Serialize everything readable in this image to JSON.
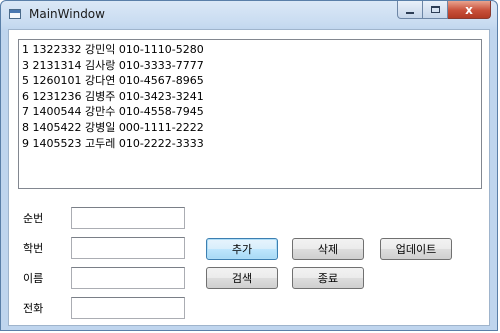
{
  "window": {
    "title": "MainWindow",
    "close_glyph": "x",
    "min_icon": "minimize-icon",
    "max_icon": "maximize-icon",
    "app_icon": "window-icon"
  },
  "list": {
    "items": [
      "1 1322332 강민익 010-1110-5280",
      "3 2131314 김사랑 010-3333-7777",
      "5 1260101 강다연 010-4567-8965",
      "6 1231236 김병주 010-3423-3241",
      "7 1400544 강만수 010-4558-7945",
      "8 1405422 강병일 000-1111-2222",
      "9 1405523 고두레 010-2222-3333"
    ]
  },
  "form": {
    "labels": {
      "number": "순번",
      "student_id": "학번",
      "name": "이름",
      "phone": "전화"
    },
    "values": {
      "number": "",
      "student_id": "",
      "name": "",
      "phone": ""
    }
  },
  "buttons": {
    "add": "추가",
    "delete": "삭제",
    "update": "업데이트",
    "search": "검색",
    "exit": "종료"
  },
  "colors": {
    "close_button": "#c8503a",
    "default_button_border": "#3c7fb1",
    "window_frame": "#bfd5ee"
  }
}
